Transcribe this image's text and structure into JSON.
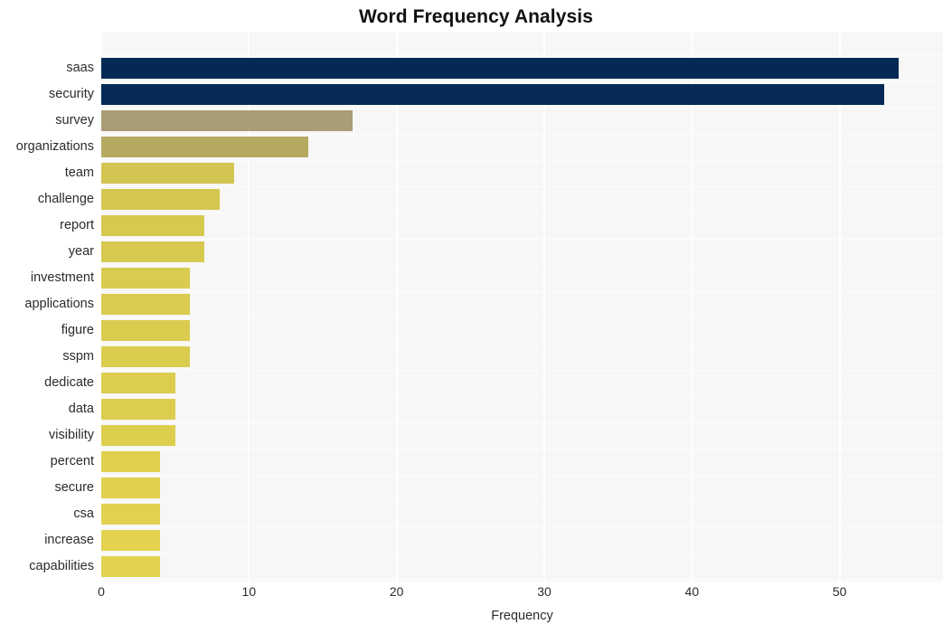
{
  "chart_data": {
    "type": "bar",
    "orientation": "horizontal",
    "title": "Word Frequency Analysis",
    "xlabel": "Frequency",
    "ylabel": "",
    "xlim": [
      0,
      57
    ],
    "ylim": null,
    "grid": true,
    "legend": null,
    "xticks": [
      0,
      10,
      20,
      30,
      40,
      50
    ],
    "xtick_labels": [
      "0",
      "10",
      "20",
      "30",
      "40",
      "50"
    ],
    "categories": [
      "saas",
      "security",
      "survey",
      "organizations",
      "team",
      "challenge",
      "report",
      "year",
      "investment",
      "applications",
      "figure",
      "sspm",
      "dedicate",
      "data",
      "visibility",
      "percent",
      "secure",
      "csa",
      "increase",
      "capabilities"
    ],
    "values": [
      54,
      53,
      17,
      14,
      9,
      8,
      7,
      7,
      6,
      6,
      6,
      6,
      5,
      5,
      5,
      4,
      4,
      4,
      4,
      4
    ],
    "bar_colors": [
      "#042954",
      "#042a55",
      "#a99d76",
      "#b5a962",
      "#d3c551",
      "#d5c750",
      "#d7c950",
      "#d7c950",
      "#d9cb4f",
      "#d9cb4f",
      "#dacc4f",
      "#dacc4f",
      "#dccd4e",
      "#dccd4e",
      "#ddce4e",
      "#e0d04e",
      "#e0d04e",
      "#e1d14e",
      "#e2d24e",
      "#e2d24e"
    ],
    "plot_background": "#f7f7f7",
    "gridline_color": "#ffffff",
    "page_background": "#ffffff",
    "text_color": "#2b2b2b",
    "title_color": "#111111"
  }
}
